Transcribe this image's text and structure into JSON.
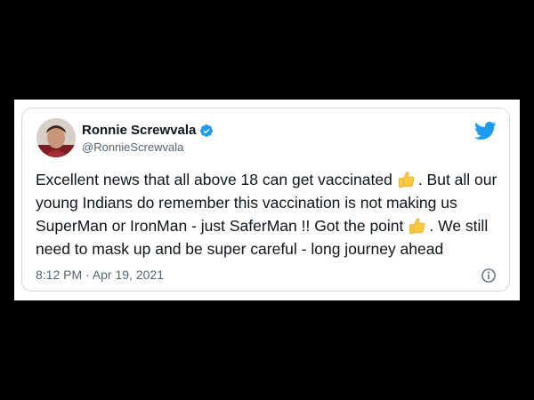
{
  "tweet": {
    "author": {
      "display_name": "Ronnie Screwvala",
      "handle": "@RonnieScrewvala",
      "verified": true
    },
    "text_segments": [
      "Excellent news that all above 18 can get vaccinated",
      ". But all our young Indians do remember this vaccination is not making us SuperMan or IronMan - just SaferMan !! Got the point",
      ". We still need to mask up and be super careful - long journey ahead"
    ],
    "emoji": "thumbs-up",
    "timestamp": "8:12 PM · Apr 19, 2021"
  },
  "icons": {
    "brand": "twitter-bird-icon",
    "verified": "verified-badge-icon",
    "info": "info-icon"
  },
  "colors": {
    "brand_blue": "#1d9bf0",
    "text_primary": "#0f1419",
    "text_secondary": "#536471",
    "border": "#cfd9de",
    "emoji_yellow": "#ffc83d"
  }
}
